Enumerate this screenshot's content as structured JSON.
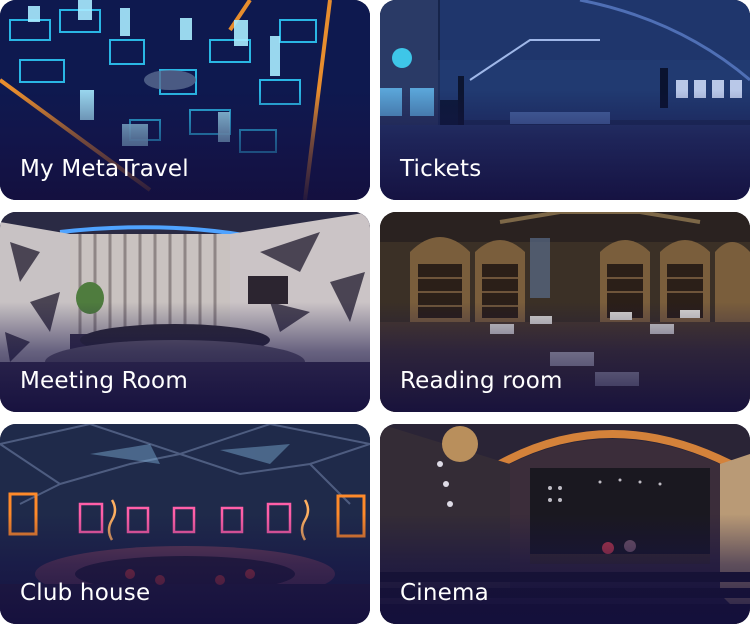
{
  "rooms": [
    {
      "name": "My MetaTravel",
      "scene": "city-grid"
    },
    {
      "name": "Tickets",
      "scene": "ticket-hall"
    },
    {
      "name": "Meeting Room",
      "scene": "meeting-room"
    },
    {
      "name": "Reading room",
      "scene": "library"
    },
    {
      "name": "Club house",
      "scene": "dome-club"
    },
    {
      "name": "Cinema",
      "scene": "cinema-stage"
    }
  ],
  "colors": {
    "label_text": "#ffffff",
    "overlay": "#14103e",
    "page_background": "#ffffff"
  }
}
